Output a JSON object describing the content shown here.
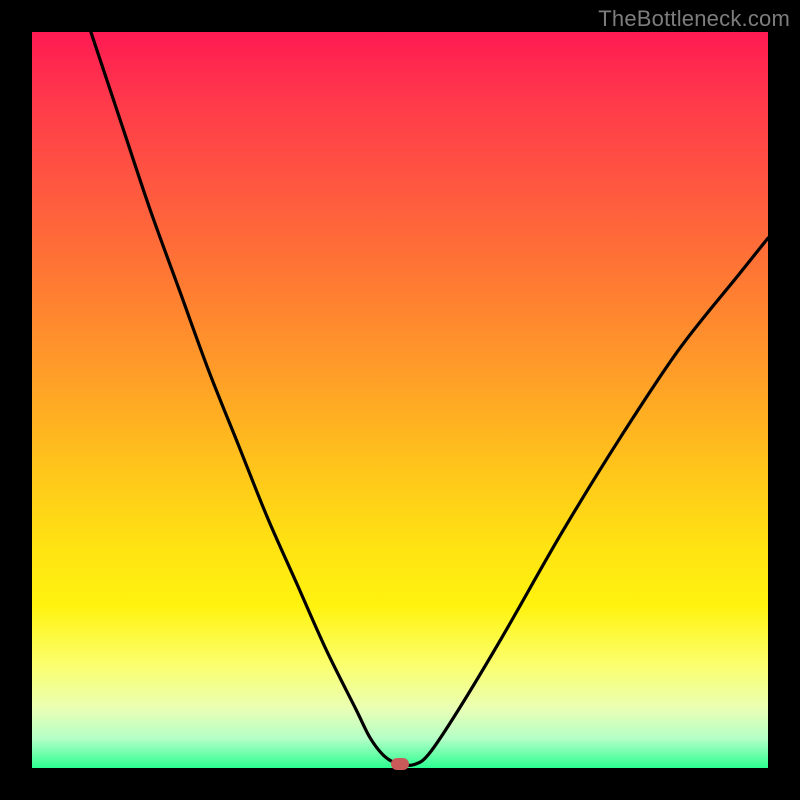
{
  "watermark": "TheBottleneck.com",
  "chart_data": {
    "type": "line",
    "title": "",
    "xlabel": "",
    "ylabel": "",
    "xlim": [
      0,
      100
    ],
    "ylim": [
      0,
      100
    ],
    "grid": false,
    "legend": false,
    "series": [
      {
        "name": "curve",
        "x": [
          8,
          12,
          16,
          20,
          24,
          28,
          32,
          36,
          40,
          44,
          46,
          48,
          50,
          52,
          54,
          58,
          64,
          72,
          80,
          88,
          96,
          100
        ],
        "y": [
          100,
          88,
          76,
          65,
          54,
          44,
          34,
          25,
          16,
          8,
          4,
          1.5,
          0.5,
          0.5,
          2,
          8,
          18,
          32,
          45,
          57,
          67,
          72
        ]
      }
    ],
    "marker": {
      "x": 50,
      "y": 0.5
    },
    "gradient_stops": [
      {
        "pos": 0,
        "color": "#ff1a53"
      },
      {
        "pos": 50,
        "color": "#ffc71a"
      },
      {
        "pos": 80,
        "color": "#fff30f"
      },
      {
        "pos": 100,
        "color": "#2dff92"
      }
    ]
  }
}
